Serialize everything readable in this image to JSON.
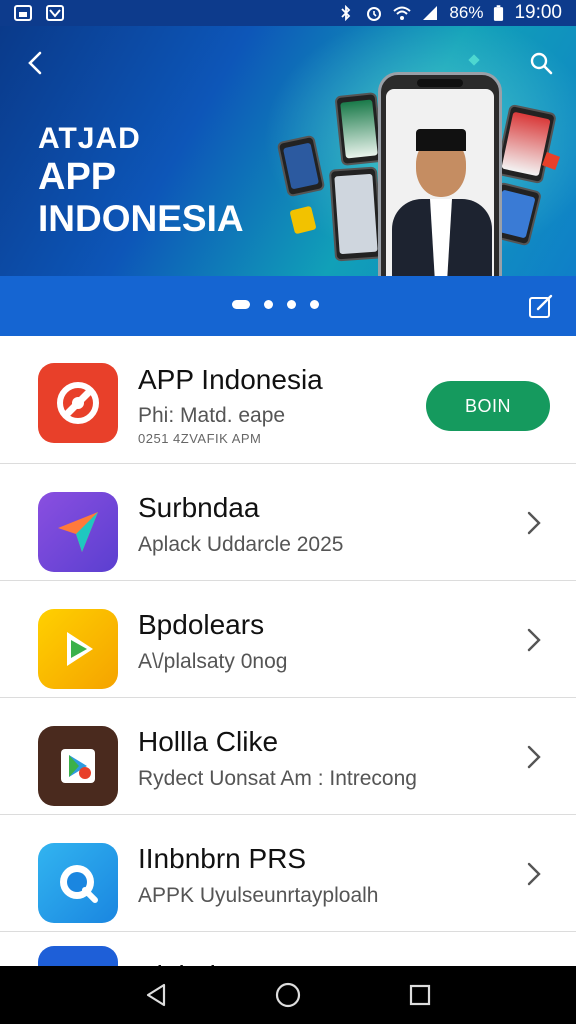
{
  "status_bar": {
    "battery": "86%",
    "time": "19:00"
  },
  "hero": {
    "title_line1": "ATJAD",
    "title_line2": "APP",
    "title_line3": "INDONESIA"
  },
  "carousel": {
    "slides": 4,
    "active_index": 0
  },
  "apps": [
    {
      "title": "APP Indonesia",
      "subtitle": "Phi: Matd. eape",
      "detail": "0251 4ZVAFIK APM",
      "action_label": "BOIN",
      "icon": "orange-badge-icon",
      "icon_color": "#e8402a"
    },
    {
      "title": "Surbndaa",
      "subtitle": "Aplack Uddarcle 2025",
      "icon": "paper-plane-icon",
      "icon_color": "#6d4fd8"
    },
    {
      "title": "Bpdolears",
      "subtitle": "A\\/plalsaty 0nog",
      "icon": "play-arrow-icon",
      "icon_color": "#f5b800"
    },
    {
      "title": "Hollla Clike",
      "subtitle": "Rydect Uonsat Am : Intrecong",
      "icon": "map-pin-icon",
      "icon_color": "#4a2a1e"
    },
    {
      "title": "IInbnbrn PRS",
      "subtitle": "APPK Uyulseunrtayploalh",
      "icon": "search-lens-icon",
      "icon_color": "#1e9be8"
    },
    {
      "title": "Plabolevenrs",
      "icon": "camera-icon",
      "icon_color": "#1e5fd8"
    }
  ]
}
